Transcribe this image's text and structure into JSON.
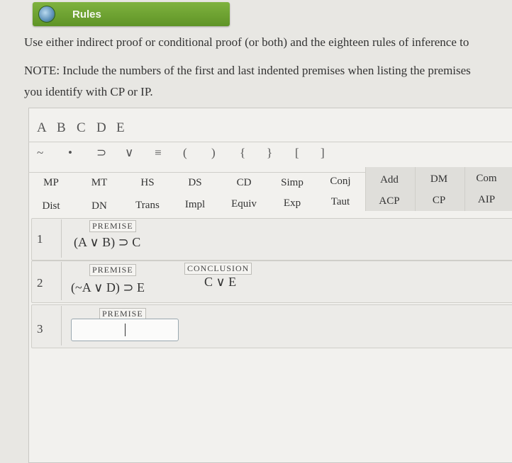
{
  "header": {
    "rules_label": "Rules",
    "icon": "globe-icon"
  },
  "instructions": {
    "line1": "Use either indirect proof or conditional proof (or both) and the eighteen rules of inference to",
    "note_line1": "NOTE: Include the numbers of the first and last indented premises when listing the premises",
    "note_line2": "you identify with CP or IP."
  },
  "variables": [
    "A",
    "B",
    "C",
    "D",
    "E"
  ],
  "symbols": [
    "~",
    "•",
    "⊃",
    "∨",
    "≡",
    "(",
    ")",
    "{",
    "}",
    "[",
    "]"
  ],
  "rules_row1": [
    "MP",
    "MT",
    "HS",
    "DS",
    "CD",
    "Simp",
    "Conj",
    "Add",
    "DM",
    "Com"
  ],
  "rules_row2": [
    "Dist",
    "DN",
    "Trans",
    "Impl",
    "Equiv",
    "Exp",
    "Taut",
    "ACP",
    "CP",
    "AIP"
  ],
  "lines": [
    {
      "num": "1",
      "tag": "PREMISE",
      "formula": "(A ∨ B) ⊃ C"
    },
    {
      "num": "2",
      "tag": "PREMISE",
      "formula": "(~A ∨ D) ⊃ E",
      "conclusion_tag": "CONCLUSION",
      "conclusion": "C ∨ E"
    },
    {
      "num": "3",
      "tag": "PREMISE",
      "formula": ""
    }
  ]
}
